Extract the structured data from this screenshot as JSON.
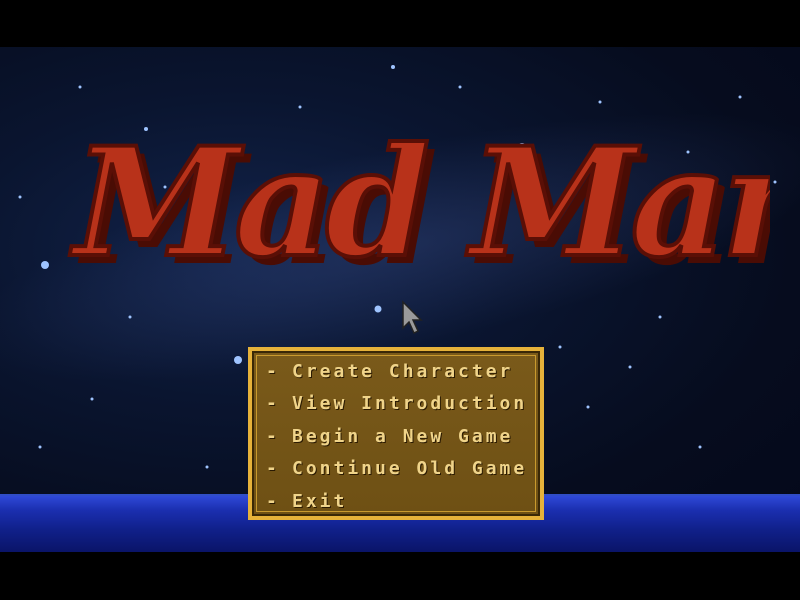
{
  "game": {
    "logo_text": "Mad Man",
    "menu": {
      "items": [
        {
          "dash": "-",
          "label": "Create Character"
        },
        {
          "dash": "-",
          "label": "View Introduction"
        },
        {
          "dash": "-",
          "label": "Begin a New Game"
        },
        {
          "dash": "-",
          "label": "Continue Old Game"
        },
        {
          "dash": "-",
          "label": "Exit"
        }
      ]
    }
  },
  "colors": {
    "logo": "#b8321a",
    "menu_border": "#e6b23a",
    "menu_background": "#7a5a1a",
    "menu_text": "#f0d48a",
    "horizon": "#1b2fb0"
  }
}
